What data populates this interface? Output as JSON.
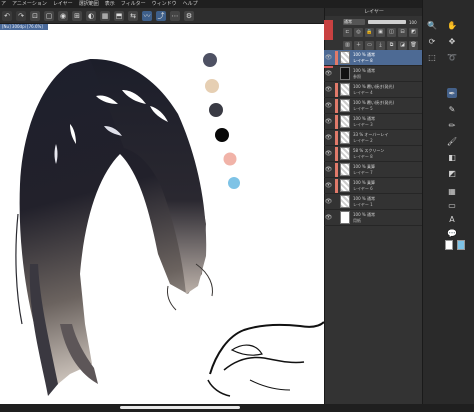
{
  "menu": {
    "items": [
      "ア",
      "アニメーション",
      "レイヤー",
      "選択範囲",
      "表示",
      "フィルター",
      "ウィンドウ",
      "ヘルプ"
    ]
  },
  "document": {
    "tab_title": "[Nu] 300dpi [76.6%]"
  },
  "color_palette": [
    "#4e5163",
    "#e6cfb3",
    "#3a3b44",
    "#080808",
    "#f1b3a8",
    "#7ec3e6"
  ],
  "layer_panel": {
    "title": "レイヤー",
    "blend_mode": "通常",
    "opacity_value": "100",
    "layers": [
      {
        "mode": "100 % 通常",
        "name": "レイヤー 8",
        "selected": true,
        "clip": "#e07a6a",
        "thumb": "checker",
        "eye": "👁"
      },
      {
        "mode": "100 % 通常",
        "name": "参照",
        "selected": false,
        "clip": "",
        "thumb": "dark",
        "eye": "👁"
      },
      {
        "mode": "100 % 覆い焼き(発光)",
        "name": "レイヤー 4",
        "selected": false,
        "clip": "#e07a6a",
        "thumb": "checker",
        "eye": "👁"
      },
      {
        "mode": "100 % 覆い焼き(発光)",
        "name": "レイヤー 5",
        "selected": false,
        "clip": "#e07a6a",
        "thumb": "checker",
        "eye": "👁"
      },
      {
        "mode": "100 % 通常",
        "name": "レイヤー 3",
        "selected": false,
        "clip": "#e07a6a",
        "thumb": "checker",
        "eye": "👁"
      },
      {
        "mode": "33 % オーバーレイ",
        "name": "レイヤー 2",
        "selected": false,
        "clip": "#e07a6a",
        "thumb": "checker",
        "eye": "👁"
      },
      {
        "mode": "58 % スクリーン",
        "name": "レイヤー 8",
        "selected": false,
        "clip": "#e07a6a",
        "thumb": "checker",
        "eye": "👁"
      },
      {
        "mode": "100 % 乗算",
        "name": "レイヤー 7",
        "selected": false,
        "clip": "#e07a6a",
        "thumb": "checker",
        "eye": "👁"
      },
      {
        "mode": "100 % 乗算",
        "name": "レイヤー 6",
        "selected": false,
        "clip": "#e07a6a",
        "thumb": "checker",
        "eye": "👁"
      },
      {
        "mode": "100 % 通常",
        "name": "レイヤー 1",
        "selected": false,
        "clip": "",
        "thumb": "checker",
        "eye": "👁"
      },
      {
        "mode": "100 % 通常",
        "name": "用紙",
        "selected": false,
        "clip": "",
        "thumb": "white",
        "eye": "👁"
      }
    ]
  },
  "tools": [
    {
      "name": "zoom-tool",
      "icon": "🔍",
      "selected": false
    },
    {
      "name": "hand-tool",
      "icon": "✋",
      "selected": false
    },
    {
      "name": "rotate-tool",
      "icon": "⟳",
      "selected": false
    },
    {
      "name": "move-tool",
      "icon": "✥",
      "selected": false
    },
    {
      "name": "select-tool",
      "icon": "⬚",
      "selected": false
    },
    {
      "name": "lasso-tool",
      "icon": "➰",
      "selected": false
    },
    {
      "name": "eyedropper-tool",
      "icon": "✒",
      "selected": true
    },
    {
      "name": "pen-tool",
      "icon": "✎",
      "selected": false
    },
    {
      "name": "pencil-tool",
      "icon": "✏",
      "selected": false
    },
    {
      "name": "brush-tool",
      "icon": "🖌",
      "selected": false
    },
    {
      "name": "eraser-tool",
      "icon": "◧",
      "selected": false
    },
    {
      "name": "fill-tool",
      "icon": "◩",
      "selected": false
    },
    {
      "name": "gradient-tool",
      "icon": "▦",
      "selected": false
    },
    {
      "name": "shape-tool",
      "icon": "▭",
      "selected": false
    },
    {
      "name": "text-tool",
      "icon": "A",
      "selected": false
    },
    {
      "name": "balloon-tool",
      "icon": "💬",
      "selected": false
    }
  ],
  "color_swatches": [
    "#ffffff",
    "#7ec3e6"
  ]
}
